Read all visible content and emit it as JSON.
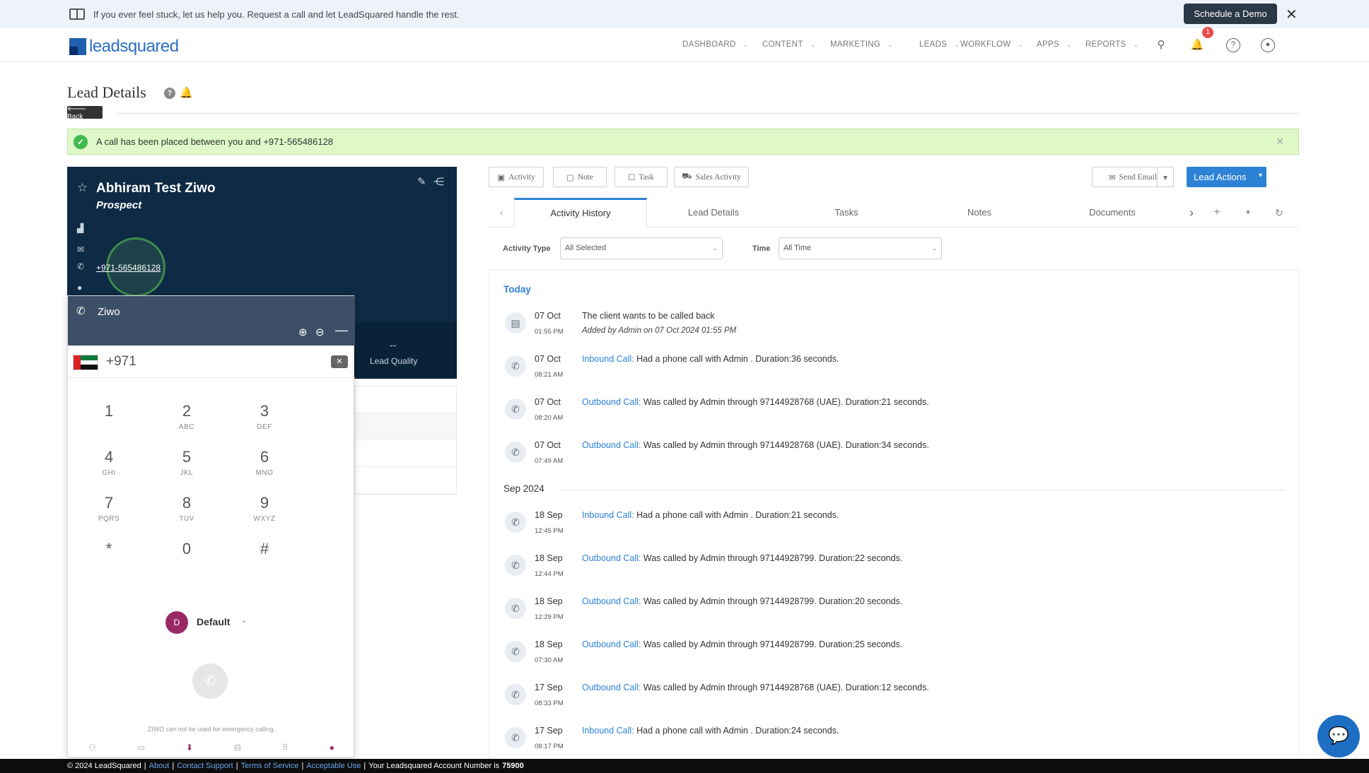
{
  "banner": {
    "text": "If you ever feel stuck, let us help you. Request a call and let LeadSquared handle the rest.",
    "demo_button": "Schedule a Demo",
    "close": "✕"
  },
  "nav": {
    "logo_text": "leadsquared",
    "items": [
      "DASHBOARD",
      "CONTENT",
      "MARKETING",
      "LEADS",
      "WORKFLOW",
      "APPS",
      "REPORTS"
    ],
    "notification_count": "1"
  },
  "page": {
    "title": "Lead Details",
    "back_label": "🡐 Back"
  },
  "alert": {
    "message": "A call has been placed between you and +971-565486128"
  },
  "lead": {
    "name": "Abhiram Test Ziwo",
    "stage": "Prospect",
    "phone": "+971-565486128",
    "lead_quality_value": "--",
    "lead_quality_label": "Lead Quality"
  },
  "dialer": {
    "title": "Ziwo",
    "number": "+971",
    "keys": [
      {
        "d": "1",
        "l": ""
      },
      {
        "d": "2",
        "l": "ABC"
      },
      {
        "d": "3",
        "l": "DEF"
      },
      {
        "d": "4",
        "l": "GHI"
      },
      {
        "d": "5",
        "l": "JKL"
      },
      {
        "d": "6",
        "l": "MNO"
      },
      {
        "d": "7",
        "l": "PQRS"
      },
      {
        "d": "8",
        "l": "TUV"
      },
      {
        "d": "9",
        "l": "WXYZ"
      },
      {
        "d": "*",
        "l": ""
      },
      {
        "d": "0",
        "l": ""
      },
      {
        "d": "#",
        "l": ""
      }
    ],
    "default_initial": "D",
    "default_label": "Default",
    "footer_note": "ZIWO can not be used for emergency calling."
  },
  "toolbar": {
    "activity": "Activity",
    "note": "Note",
    "task": "Task",
    "sales_activity": "Sales Activity",
    "send_email": "Send Email",
    "lead_actions": "Lead Actions"
  },
  "tabs": [
    "Activity History",
    "Lead Details",
    "Tasks",
    "Notes",
    "Documents"
  ],
  "filters": {
    "activity_type_label": "Activity Type",
    "activity_type_value": "All Selected",
    "time_label": "Time",
    "time_value": "All Time"
  },
  "feed": {
    "group_today": "Today",
    "group_sep": "Sep 2024",
    "items": [
      {
        "date": "07 Oct",
        "time": "01:55 PM",
        "type": "",
        "desc": "The client wants to be called back",
        "sub": "Added by Admin on 07 Oct 2024 01:55 PM"
      },
      {
        "date": "07 Oct",
        "time": "08:21 AM",
        "type": "Inbound Call:",
        "desc": " Had a phone call with Admin . Duration:36 seconds."
      },
      {
        "date": "07 Oct",
        "time": "08:20 AM",
        "type": "Outbound Call:",
        "desc": " Was called by Admin through 97144928768 (UAE). Duration:21 seconds."
      },
      {
        "date": "07 Oct",
        "time": "07:49 AM",
        "type": "Outbound Call:",
        "desc": " Was called by Admin through 97144928768 (UAE). Duration:34 seconds."
      },
      {
        "date": "18 Sep",
        "time": "12:45 PM",
        "type": "Inbound Call:",
        "desc": " Had a phone call with Admin . Duration:21 seconds."
      },
      {
        "date": "18 Sep",
        "time": "12:44 PM",
        "type": "Outbound Call:",
        "desc": " Was called by Admin through 97144928799. Duration:22 seconds."
      },
      {
        "date": "18 Sep",
        "time": "12:29 PM",
        "type": "Outbound Call:",
        "desc": " Was called by Admin through 97144928799. Duration:20 seconds."
      },
      {
        "date": "18 Sep",
        "time": "07:30 AM",
        "type": "Outbound Call:",
        "desc": " Was called by Admin through 97144928799. Duration:25 seconds."
      },
      {
        "date": "17 Sep",
        "time": "08:33 PM",
        "type": "Outbound Call:",
        "desc": " Was called by Admin through 97144928768 (UAE). Duration:12 seconds."
      },
      {
        "date": "17 Sep",
        "time": "08:17 PM",
        "type": "Inbound Call:",
        "desc": " Had a phone call with Admin . Duration:24 seconds."
      }
    ]
  },
  "footer": {
    "copyright": "© 2024 LeadSquared",
    "about": "About",
    "contact": "Contact Support",
    "terms": "Terms of Service",
    "acceptable": "Acceptable Use",
    "account": "Your Leadsquared Account Number is",
    "account_number": "75900"
  }
}
